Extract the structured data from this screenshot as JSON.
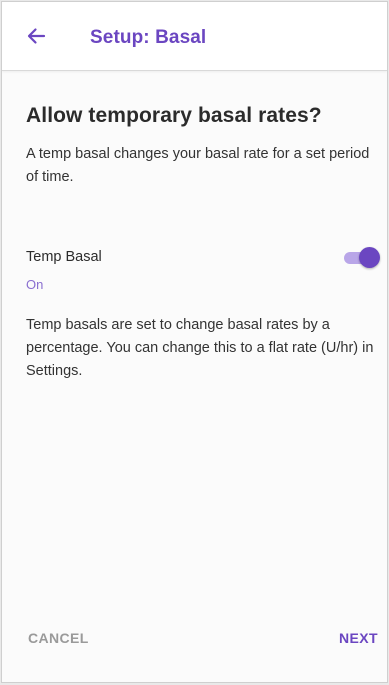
{
  "header": {
    "title": "Setup: Basal",
    "back_icon": "arrow-left-icon"
  },
  "main": {
    "heading": "Allow temporary basal rates?",
    "intro": "A temp basal changes your basal rate for a set period of time.",
    "setting": {
      "label": "Temp Basal",
      "status": "On",
      "enabled": true
    },
    "explanation": "Temp basals are set to change basal rates by a percentage. You can change this to a flat rate (U/hr) in Settings."
  },
  "footer": {
    "cancel_label": "CANCEL",
    "next_label": "NEXT"
  },
  "colors": {
    "accent": "#6b46c1",
    "accent_light": "#b9a6e8",
    "muted": "#9a9a9a"
  }
}
